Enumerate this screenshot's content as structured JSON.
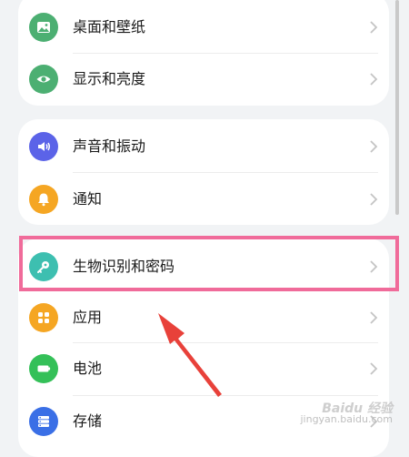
{
  "groups": [
    {
      "items": [
        {
          "label": "桌面和壁纸",
          "icon": "wallpaper-icon",
          "color": "#4caf72"
        },
        {
          "label": "显示和亮度",
          "icon": "eye-display-icon",
          "color": "#4caf72"
        }
      ]
    },
    {
      "items": [
        {
          "label": "声音和振动",
          "icon": "sound-icon",
          "color": "#5b63e8"
        },
        {
          "label": "通知",
          "icon": "bell-icon",
          "color": "#f5a623"
        }
      ]
    },
    {
      "items": [
        {
          "label": "生物识别和密码",
          "icon": "key-icon",
          "color": "#3dbfb0"
        },
        {
          "label": "应用",
          "icon": "apps-grid-icon",
          "color": "#f5a623"
        },
        {
          "label": "电池",
          "icon": "battery-icon",
          "color": "#34c058"
        },
        {
          "label": "存储",
          "icon": "storage-icon",
          "color": "#3a6fe6"
        }
      ]
    }
  ],
  "annotation": {
    "highlight_color": "#f06b9a",
    "arrow_color": "#e8413a"
  },
  "watermark": {
    "line1": "Baidu 经验",
    "line2": "jingyan.baidu.com"
  }
}
